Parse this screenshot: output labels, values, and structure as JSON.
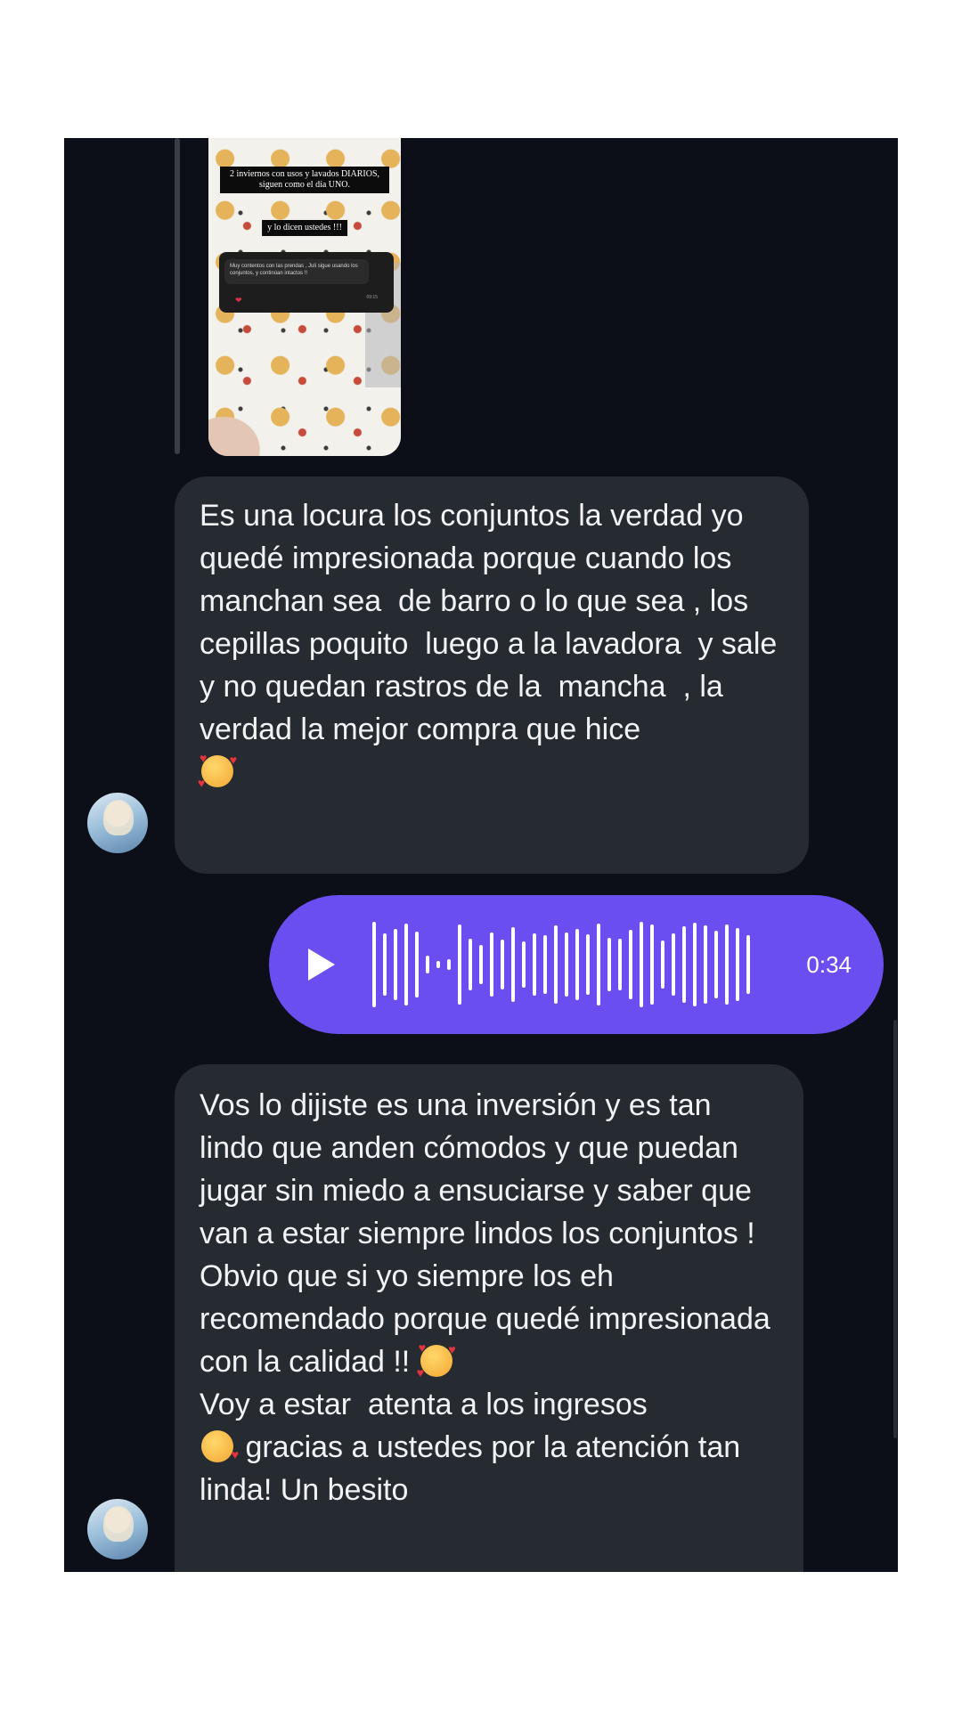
{
  "shared_post": {
    "caption_1": "2 inviernos con usos y lavados DIARIOS, siguen como el día UNO.",
    "caption_2": "y lo dicen ustedes !!!",
    "quote_text": "Muy contentos con las prendas , Juli sigue usando los conjuntos, y continúan intactos !!",
    "quote_time": "09:15"
  },
  "messages": [
    {
      "text": "Es una locura los conjuntos la verdad yo quedé impresionada porque cuando los manchan sea  de barro o lo que sea , los cepillas poquito  luego a la lavadora  y sale y no quedan rastros de la  mancha  , la verdad la mejor compra que hice",
      "emoji": "smiling-face-with-hearts"
    },
    {
      "part_1": "Vos lo dijiste es una inversión y es tan lindo que anden cómodos y que puedan jugar sin miedo a ensuciarse y saber que van a estar siempre lindos los conjuntos !\nObvio que si yo siempre los eh recomendado porque quedé impresionada con la calidad !! ",
      "emoji_1": "smiling-face-with-hearts",
      "part_2": "\nVoy a estar  atenta a los ingresos\n",
      "emoji_2": "face-blowing-a-kiss",
      "part_3": " gracias a ustedes por la atención tan linda! Un besito"
    }
  ],
  "voice_message": {
    "duration": "0:34",
    "icon": "play-icon",
    "color": "#6b4ef0"
  },
  "colors": {
    "background": "#0c0f17",
    "bubble": "#262a31",
    "text": "#f2f3f5"
  }
}
